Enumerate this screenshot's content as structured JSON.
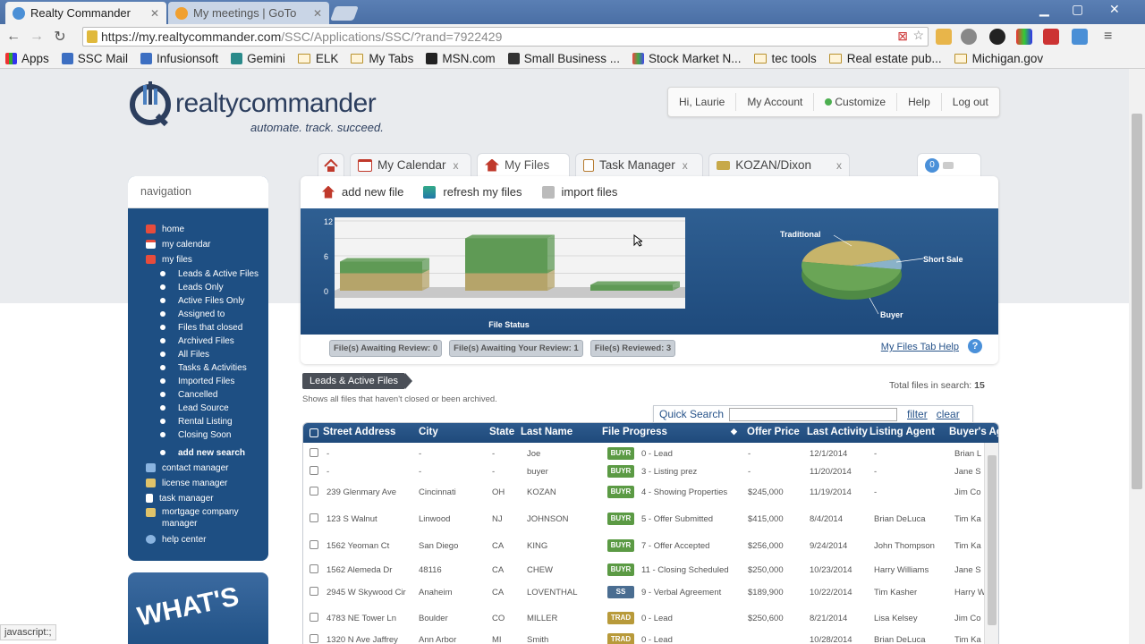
{
  "browser": {
    "tabs": [
      {
        "label": "Realty Commander",
        "active": true
      },
      {
        "label": "My meetings | GoTo",
        "active": false
      }
    ],
    "url_host": "https://my.realtycommander.com",
    "url_path": "/SSC/Applications/SSC/?rand=7922429",
    "bookmarks": [
      {
        "label": "Apps",
        "icon": "apps-grid-icon"
      },
      {
        "label": "SSC Mail",
        "icon": "ssc-icon"
      },
      {
        "label": "Infusionsoft",
        "icon": "infusionsoft-icon"
      },
      {
        "label": "Gemini",
        "icon": "gemini-icon"
      },
      {
        "label": "ELK",
        "icon": "folder-icon"
      },
      {
        "label": "My Tabs",
        "icon": "folder-icon"
      },
      {
        "label": "MSN.com",
        "icon": "msn-icon"
      },
      {
        "label": "Small Business ...",
        "icon": "sb-icon"
      },
      {
        "label": "Stock Market N...",
        "icon": "stock-icon"
      },
      {
        "label": "tec tools",
        "icon": "folder-icon"
      },
      {
        "label": "Real estate pub...",
        "icon": "folder-icon"
      },
      {
        "label": "Michigan.gov",
        "icon": "folder-icon"
      }
    ],
    "status_text": "javascript:;"
  },
  "header": {
    "logo_name": "realtycommander",
    "logo_tagline": "automate. track. succeed.",
    "user_nav": [
      "Hi, Laurie",
      "My Account",
      "Customize",
      "Help",
      "Log out"
    ]
  },
  "app_tabs": [
    {
      "label": "My Calendar",
      "closable": true
    },
    {
      "label": "My Files",
      "closable": false
    },
    {
      "label": "Task Manager",
      "closable": true
    },
    {
      "label": "KOZAN/Dixon",
      "closable": true
    }
  ],
  "notifications_count": "0",
  "navigation": {
    "title": "navigation",
    "items": [
      {
        "label": "home",
        "icon": "home-icon"
      },
      {
        "label": "my calendar",
        "icon": "calendar-icon"
      },
      {
        "label": "my files",
        "icon": "files-icon"
      }
    ],
    "sub_items": [
      "Leads & Active Files",
      "Leads Only",
      "Active Files Only",
      "Assigned to",
      "Files that closed",
      "Archived Files",
      "All Files",
      "Tasks & Activities",
      "Imported Files",
      "Cancelled",
      "Lead Source",
      "Rental Listing",
      "Closing Soon"
    ],
    "add_search": "add new search",
    "bottom_items": [
      {
        "label": "contact manager",
        "icon": "contact-icon"
      },
      {
        "label": "license manager",
        "icon": "license-icon"
      },
      {
        "label": "task manager",
        "icon": "task-icon"
      },
      {
        "label": "mortgage company manager",
        "icon": "mortgage-icon"
      },
      {
        "label": "help center",
        "icon": "help-icon"
      }
    ],
    "whats_new": "WHAT'S"
  },
  "actions": [
    "add new file",
    "refresh my files",
    "import files"
  ],
  "chart_data": [
    {
      "type": "bar",
      "title": "File Status",
      "categories": [
        "",
        "",
        ""
      ],
      "series": [
        {
          "values": [
            3,
            3,
            0
          ]
        },
        {
          "values": [
            2,
            6,
            1
          ]
        }
      ],
      "yticks": [
        "12",
        "6",
        "0"
      ],
      "ylim": [
        0,
        12
      ],
      "colors": [
        "#b5a46a",
        "#5f9a55"
      ]
    },
    {
      "type": "pie",
      "labels": [
        "Traditional",
        "Short Sale",
        "Buyer"
      ],
      "values": [
        43,
        7,
        50
      ],
      "colors": [
        "#c7b46a",
        "#8ab2c9",
        "#6aa556"
      ]
    }
  ],
  "status_pills": [
    "File(s) Awaiting Review: 0",
    "File(s) Awaiting Your Review: 1",
    "File(s) Reviewed: 3"
  ],
  "help_link": "My Files Tab Help",
  "list": {
    "section_title": "Leads & Active Files",
    "description": "Shows all files that haven't closed or been archived.",
    "total_label": "Total files in search:",
    "total_value": "15",
    "quick_search_label": "Quick Search",
    "filter_label": "filter",
    "clear_label": "clear",
    "columns": [
      "Street Address",
      "City",
      "State",
      "Last Name",
      "File Progress",
      "Offer Price",
      "Last Activity",
      "Listing Agent",
      "Buyer's Ag"
    ],
    "rows": [
      {
        "street": "-",
        "city": "-",
        "state": "-",
        "last": "Joe",
        "badge": "BUYR",
        "progress": "0 - Lead",
        "price": "-",
        "activity": "12/1/2014",
        "agent": "-",
        "buyer": "Brian L"
      },
      {
        "street": "-",
        "city": "-",
        "state": "-",
        "last": "buyer",
        "badge": "BUYR",
        "progress": "3 - Listing prez",
        "price": "-",
        "activity": "11/20/2014",
        "agent": "-",
        "buyer": "Jane S"
      },
      {
        "street": "239 Glenmary Ave",
        "city": "Cincinnati",
        "state": "OH",
        "last": "KOZAN",
        "badge": "BUYR",
        "progress": "4 - Showing Properties",
        "price": "$245,000",
        "activity": "11/19/2014",
        "agent": "-",
        "buyer": "Jim Co"
      },
      {
        "street": "123 S Walnut",
        "city": "Linwood",
        "state": "NJ",
        "last": "JOHNSON",
        "badge": "BUYR",
        "progress": "5 - Offer Submitted",
        "price": "$415,000",
        "activity": "8/4/2014",
        "agent": "Brian DeLuca",
        "buyer": "Tim Ka"
      },
      {
        "street": "1562 Yeoman Ct",
        "city": "San Diego",
        "state": "CA",
        "last": "KING",
        "badge": "BUYR",
        "progress": "7 - Offer Accepted",
        "price": "$256,000",
        "activity": "9/24/2014",
        "agent": "John Thompson",
        "buyer": "Tim Ka"
      },
      {
        "street": "1562 Alemeda Dr",
        "city": "48116",
        "state": "CA",
        "last": "CHEW",
        "badge": "BUYR",
        "progress": "11 - Closing Scheduled",
        "price": "$250,000",
        "activity": "10/23/2014",
        "agent": "Harry Williams",
        "buyer": "Jane S"
      },
      {
        "street": "2945 W Skywood Cir",
        "city": "Anaheim",
        "state": "CA",
        "last": "LOVENTHAL",
        "badge": "SS",
        "progress": "9 - Verbal Agreement",
        "price": "$189,900",
        "activity": "10/22/2014",
        "agent": "Tim Kasher",
        "buyer": "Harry W"
      },
      {
        "street": "4783 NE Tower Ln",
        "city": "Boulder",
        "state": "CO",
        "last": "MILLER",
        "badge": "TRAD",
        "progress": "0 - Lead",
        "price": "$250,600",
        "activity": "8/21/2014",
        "agent": "Lisa Kelsey",
        "buyer": "Jim Co"
      },
      {
        "street": "1320 N Ave Jaffrey",
        "city": "Ann Arbor",
        "state": "MI",
        "last": "Smith",
        "badge": "TRAD",
        "progress": "0 - Lead",
        "price": "",
        "activity": "10/28/2014",
        "agent": "Brian DeLuca",
        "buyer": "Tim Ka"
      }
    ]
  }
}
